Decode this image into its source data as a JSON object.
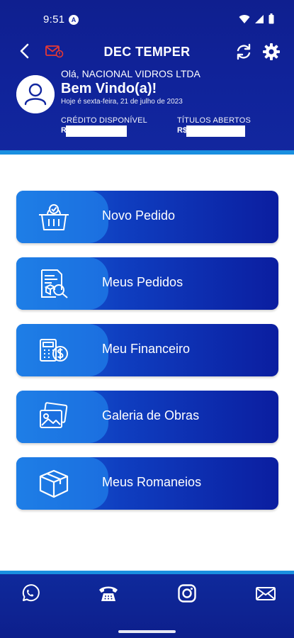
{
  "status": {
    "time": "9:51",
    "badge": "A"
  },
  "header": {
    "title": "DEC TEMPER",
    "greeting": "Olá, NACIONAL VIDROS LTDA",
    "welcome": "Bem Vindo(a)!",
    "date": "Hoje é sexta-feira, 21 de julho de 2023",
    "credit_label": "CRÉDITO DISPONÍVEL",
    "credit_prefix": "R",
    "titles_label": "TÍTULOS ABERTOS",
    "titles_prefix": "R$"
  },
  "menu": [
    {
      "label": "Novo Pedido",
      "icon": "shopping-basket-icon"
    },
    {
      "label": "Meus Pedidos",
      "icon": "document-search-icon"
    },
    {
      "label": "Meu Financeiro",
      "icon": "calculator-money-icon"
    },
    {
      "label": "Galeria de Obras",
      "icon": "photo-gallery-icon"
    },
    {
      "label": "Meus Romaneios",
      "icon": "box-icon"
    }
  ],
  "bottom_nav": [
    "whatsapp-icon",
    "phone-icon",
    "instagram-icon",
    "email-icon"
  ],
  "colors": {
    "primary": "#12279f",
    "accent": "#1a8fe0",
    "alert": "#e53935"
  }
}
